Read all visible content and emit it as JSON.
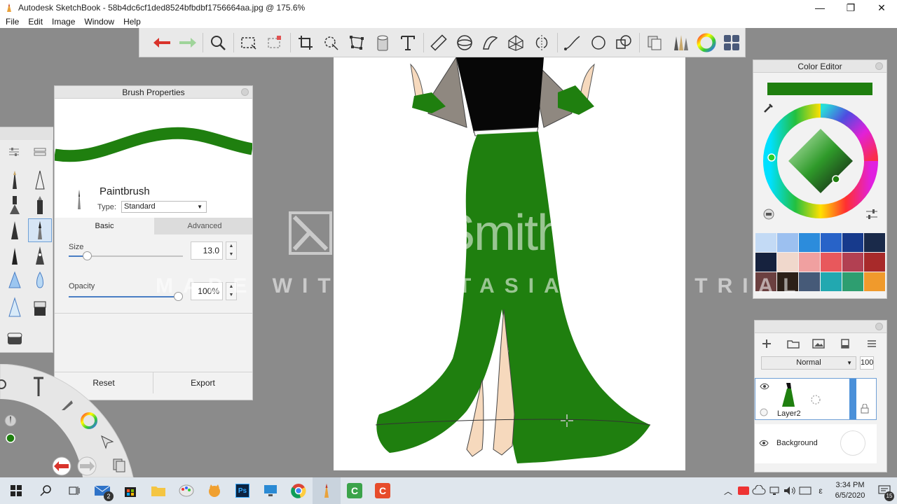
{
  "window": {
    "title": "Autodesk SketchBook - 58b4dc6cf1ded8524bfbdbf1756664aa.jpg @ 175.6%",
    "minimize": "—",
    "maximize": "❐",
    "close": "✕"
  },
  "menu": [
    "File",
    "Edit",
    "Image",
    "Window",
    "Help"
  ],
  "toolbar": {
    "icons": [
      "undo-icon",
      "redo-icon",
      "zoom-icon",
      "rect-select-icon",
      "lasso-select-icon",
      "crop-icon",
      "transform-icon",
      "distort-icon",
      "fill-icon",
      "text-icon",
      "ruler-icon",
      "ellipse-guide-icon",
      "french-curve-icon",
      "perspective-icon",
      "symmetry-icon",
      "stroke-icon",
      "ellipse-icon",
      "shape-icon",
      "copy-paste-icon",
      "brushes-icon",
      "color-wheel-icon",
      "palette-icon"
    ]
  },
  "brush_properties": {
    "title": "Brush Properties",
    "brush_name": "Paintbrush",
    "type_label": "Type:",
    "type_value": "Standard",
    "tabs": {
      "basic": "Basic",
      "advanced": "Advanced"
    },
    "size_label": "Size",
    "size_value": "13.0",
    "size_fraction": 0.1,
    "opacity_label": "Opacity",
    "opacity_value": "100%",
    "opacity_fraction": 1.0,
    "reset_label": "Reset",
    "export_label": "Export",
    "stroke_color": "#1f7f0f"
  },
  "color_editor": {
    "title": "Color Editor",
    "current_color": "#1f7f0f",
    "swatches": [
      "#c3daf5",
      "#9cc0f0",
      "#2c8cdc",
      "#2863c8",
      "#173a8c",
      "#1a2a4a",
      "#16223e",
      "#f0d8cc",
      "#f0a0a0",
      "#e8585c",
      "#b24052",
      "#a82a2a",
      "#6b4040",
      "#2c2018",
      "#465a78",
      "#22a8b0",
      "#2e9e70",
      "#f09a2c"
    ]
  },
  "layers": {
    "blend_mode": "Normal",
    "opacity": "100",
    "items": [
      {
        "name": "Layer2",
        "selected": true
      },
      {
        "name": "Background",
        "selected": false
      }
    ]
  },
  "watermark": {
    "brand": "TechSmith",
    "registered": "®",
    "line": "MADE WITH CAMTASIA FREE TRIAL"
  },
  "taskbar": {
    "mail_badge": "2",
    "time": "3:34 PM",
    "date": "6/5/2020",
    "lang": "ε",
    "notification_count": "15"
  },
  "colors": {
    "accent_green": "#1f7f0f",
    "workspace_gray": "#8b8b8b",
    "selection_blue": "#4a7ec4"
  }
}
